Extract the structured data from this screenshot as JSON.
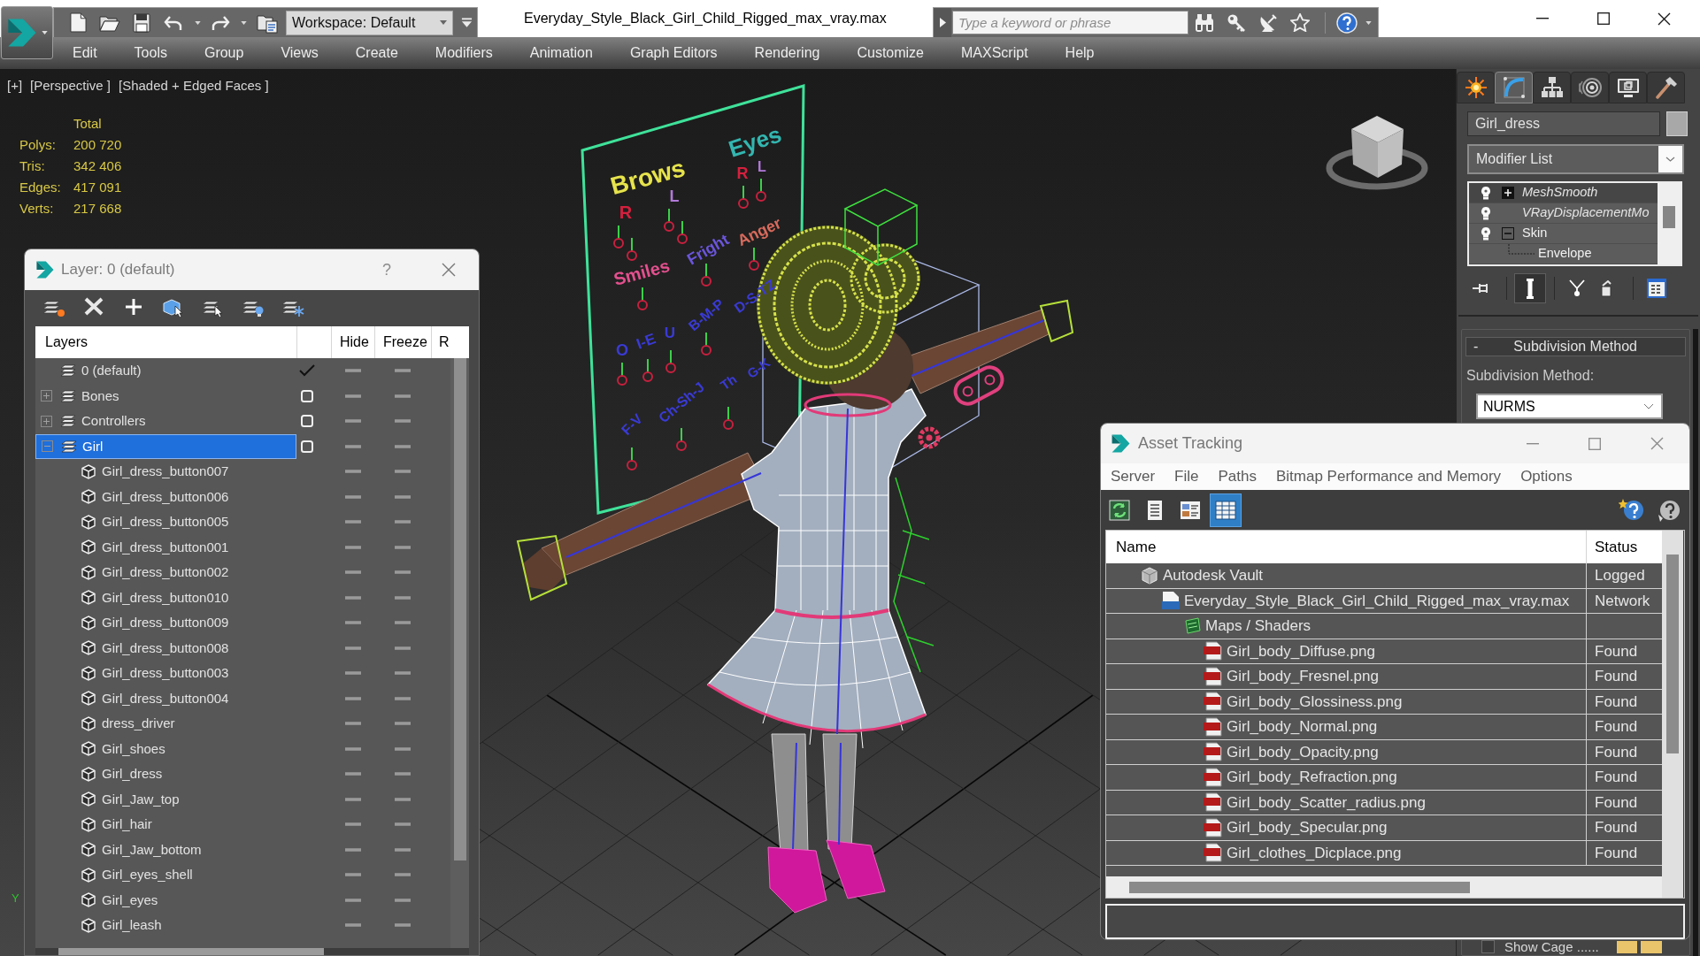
{
  "title_bar": {
    "workspace": "Workspace: Default",
    "title": "Everyday_Style_Black_Girl_Child_Rigged_max_vray.max",
    "search": {
      "placeholder": "Type a keyword or phrase"
    }
  },
  "menu": [
    "Edit",
    "Tools",
    "Group",
    "Views",
    "Create",
    "Modifiers",
    "Animation",
    "Graph Editors",
    "Rendering",
    "Customize",
    "MAXScript",
    "Help"
  ],
  "viewport": {
    "labels": [
      "[+]",
      "[Perspective ]",
      "[Shaded + Edged Faces ]"
    ],
    "stats": {
      "header": "Total",
      "rows": [
        {
          "label": "Polys:",
          "value": "200 720"
        },
        {
          "label": "Tris:",
          "value": "342 406"
        },
        {
          "label": "Edges:",
          "value": "417 091"
        },
        {
          "label": "Verts:",
          "value": "217 668"
        }
      ]
    },
    "rig_labels": [
      {
        "text": "Brows",
        "color": "#e6e34c"
      },
      {
        "text": "Eyes",
        "color": "#33b6b0"
      },
      {
        "text": "R",
        "color": "#d4203e"
      },
      {
        "text": "L",
        "color": "#b27ad9"
      },
      {
        "text": "R",
        "color": "#d4203e"
      },
      {
        "text": "L",
        "color": "#b27ad9"
      },
      {
        "text": "Smiles",
        "color": "#e4508e"
      },
      {
        "text": "Fright",
        "color": "#6b55dc"
      },
      {
        "text": "Anger",
        "color": "#d86a5c"
      },
      {
        "text": "O",
        "color": "#3a3ad6"
      },
      {
        "text": "I-E",
        "color": "#3a3ad6"
      },
      {
        "text": "U",
        "color": "#3a3ad6"
      },
      {
        "text": "B-M-P",
        "color": "#3a3ad6"
      },
      {
        "text": "D-S-TZ",
        "color": "#3a3ad6"
      },
      {
        "text": "F-V",
        "color": "#3a3ad6"
      },
      {
        "text": "Ch-Sh-J",
        "color": "#3a3ad6"
      },
      {
        "text": "Th",
        "color": "#3a3ad6"
      },
      {
        "text": "G-K",
        "color": "#3a3ad6"
      }
    ],
    "axis_label": "Y"
  },
  "layer_dialog": {
    "title": "Layer: 0 (default)",
    "help": "?",
    "columns": [
      "Layers",
      "Hide",
      "Freeze",
      "R"
    ],
    "layers": [
      {
        "name": "0 (default)",
        "kind": "layer",
        "current": true,
        "selected": false,
        "hidden": false,
        "frozen": false
      },
      {
        "name": "Bones",
        "kind": "layer",
        "current": false,
        "selected": false,
        "expanded": false,
        "hidden": false,
        "frozen": false
      },
      {
        "name": "Controllers",
        "kind": "layer",
        "current": false,
        "selected": false,
        "expanded": false,
        "hidden": false,
        "frozen": false
      },
      {
        "name": "Girl",
        "kind": "layer",
        "current": false,
        "selected": true,
        "expanded": true,
        "hidden": false,
        "frozen": false,
        "children": [
          {
            "name": "Girl_dress_button007",
            "kind": "object",
            "selected": false,
            "hidden": false,
            "frozen": false
          },
          {
            "name": "Girl_dress_button006",
            "kind": "object",
            "selected": false,
            "hidden": false,
            "frozen": false
          },
          {
            "name": "Girl_dress_button005",
            "kind": "object",
            "selected": false,
            "hidden": false,
            "frozen": false
          },
          {
            "name": "Girl_dress_button001",
            "kind": "object",
            "selected": false,
            "hidden": false,
            "frozen": false
          },
          {
            "name": "Girl_dress_button002",
            "kind": "object",
            "selected": false,
            "hidden": false,
            "frozen": false
          },
          {
            "name": "Girl_dress_button010",
            "kind": "object",
            "selected": false,
            "hidden": false,
            "frozen": false
          },
          {
            "name": "Girl_dress_button009",
            "kind": "object",
            "selected": false,
            "hidden": false,
            "frozen": false
          },
          {
            "name": "Girl_dress_button008",
            "kind": "object",
            "selected": false,
            "hidden": false,
            "frozen": false
          },
          {
            "name": "Girl_dress_button003",
            "kind": "object",
            "selected": false,
            "hidden": false,
            "frozen": false
          },
          {
            "name": "Girl_dress_button004",
            "kind": "object",
            "selected": false,
            "hidden": false,
            "frozen": false
          },
          {
            "name": "dress_driver",
            "kind": "object",
            "selected": false,
            "hidden": false,
            "frozen": false
          },
          {
            "name": "Girl_shoes",
            "kind": "object",
            "selected": false,
            "hidden": false,
            "frozen": false
          },
          {
            "name": "Girl_dress",
            "kind": "object",
            "selected": false,
            "hidden": false,
            "frozen": false
          },
          {
            "name": "Girl_Jaw_top",
            "kind": "object",
            "selected": false,
            "hidden": false,
            "frozen": false
          },
          {
            "name": "Girl_hair",
            "kind": "object",
            "selected": false,
            "hidden": false,
            "frozen": false
          },
          {
            "name": "Girl_Jaw_bottom",
            "kind": "object",
            "selected": false,
            "hidden": false,
            "frozen": false
          },
          {
            "name": "Girl_eyes_shell",
            "kind": "object",
            "selected": false,
            "hidden": false,
            "frozen": false
          },
          {
            "name": "Girl_eyes",
            "kind": "object",
            "selected": false,
            "hidden": false,
            "frozen": false
          },
          {
            "name": "Girl_leash",
            "kind": "object",
            "selected": false,
            "hidden": false,
            "frozen": false
          }
        ]
      }
    ]
  },
  "command_panel": {
    "tabs": [
      {
        "kind": "create",
        "selected": false
      },
      {
        "kind": "modify",
        "selected": true
      },
      {
        "kind": "hierarchy",
        "selected": false
      },
      {
        "kind": "motion",
        "selected": false
      },
      {
        "kind": "display",
        "selected": false
      },
      {
        "kind": "utilities",
        "selected": false
      }
    ],
    "object_name": "Girl_dress",
    "modifier_list": "Modifier List",
    "stack": [
      {
        "name": "MeshSmooth",
        "on": true,
        "off_in_viewport": true,
        "selected": true,
        "expanded": false
      },
      {
        "name": "VRayDisplacementMo",
        "on": true,
        "off_in_viewport": true,
        "selected": false
      },
      {
        "name": "Skin",
        "on": true,
        "off_in_viewport": false,
        "selected": false,
        "expanded": true,
        "children": [
          {
            "name": "Envelope",
            "selected": false
          }
        ]
      }
    ],
    "stack_tools": [
      {
        "kind": "pin",
        "on": false
      },
      {
        "kind": "end_result",
        "on": true
      },
      {
        "kind": "make_unique",
        "on": false
      },
      {
        "kind": "remove",
        "on": false
      },
      {
        "kind": "configure",
        "on": false
      }
    ],
    "rollout": {
      "collapse_sign": "-",
      "title": "Subdivision Method",
      "label": "Subdivision Method:",
      "value": "NURMS"
    },
    "show_cage": {
      "label": "Show Cage ......",
      "checked": false
    }
  },
  "asset_tracking": {
    "title": "Asset Tracking",
    "menu": [
      "Server",
      "File",
      "Paths",
      "Bitmap Performance and Memory",
      "Options"
    ],
    "toolbar": [
      {
        "kind": "refresh",
        "selected": false
      },
      {
        "kind": "list",
        "selected": false
      },
      {
        "kind": "thumbnails",
        "selected": false
      },
      {
        "kind": "table",
        "selected": true
      }
    ],
    "columns": [
      "Name",
      "Status"
    ],
    "assets": [
      {
        "name": "Autodesk Vault",
        "kind": "vault",
        "status": "Logged",
        "children": [
          {
            "name": "Everyday_Style_Black_Girl_Child_Rigged_max_vray.max",
            "kind": "max",
            "status": "Network",
            "children": [
              {
                "name": "Maps / Shaders",
                "kind": "maps",
                "children": [
                  {
                    "name": "Girl_body_Diffuse.png",
                    "kind": "png",
                    "status": "Found"
                  },
                  {
                    "name": "Girl_body_Fresnel.png",
                    "kind": "png",
                    "status": "Found"
                  },
                  {
                    "name": "Girl_body_Glossiness.png",
                    "kind": "png",
                    "status": "Found"
                  },
                  {
                    "name": "Girl_body_Normal.png",
                    "kind": "png",
                    "status": "Found"
                  },
                  {
                    "name": "Girl_body_Opacity.png",
                    "kind": "png",
                    "status": "Found"
                  },
                  {
                    "name": "Girl_body_Refraction.png",
                    "kind": "png",
                    "status": "Found"
                  },
                  {
                    "name": "Girl_body_Scatter_radius.png",
                    "kind": "png",
                    "status": "Found"
                  },
                  {
                    "name": "Girl_body_Specular.png",
                    "kind": "png",
                    "status": "Found"
                  },
                  {
                    "name": "Girl_clothes_Dicplace.png",
                    "kind": "png",
                    "status": "Found"
                  }
                ]
              }
            ]
          }
        ]
      }
    ]
  }
}
